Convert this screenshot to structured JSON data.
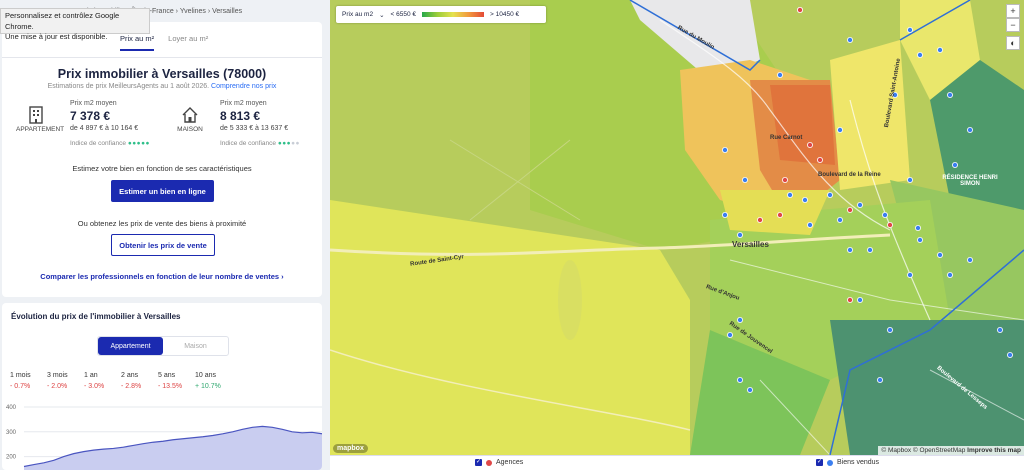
{
  "notification": {
    "line1": "Personnalisez et contrôlez Google Chrome.",
    "line2": "Une mise à jour est disponible."
  },
  "breadcrumb": "Prix immobilier › Île-de-France › Yvelines › Versailles",
  "tabs": [
    {
      "label": "Prix au m²",
      "active": true
    },
    {
      "label": "Loyer au m²",
      "active": false
    }
  ],
  "title": "Prix immobilier à Versailles (78000)",
  "subtitle": "Estimations de prix MeilleursAgents au 1 août 2026.",
  "subtitle_link": "Comprendre nos prix",
  "apartment": {
    "type_label": "APPARTEMENT",
    "label": "Prix m2 moyen",
    "price": "7 378 €",
    "range": "de 4 897 € à 10 164 €",
    "confidence_label": "Indice de confiance",
    "confidence_on": "●●●●●",
    "confidence_off": ""
  },
  "house": {
    "type_label": "MAISON",
    "label": "Prix m2 moyen",
    "price": "8 813 €",
    "range": "de 5 333 € à 13 637 €",
    "confidence_label": "Indice de confiance",
    "confidence_on": "●●●",
    "confidence_off": "●●"
  },
  "estimate_text": "Estimez votre bien en fonction de ses caractéristiques",
  "estimate_button": "Estimer un bien en ligne",
  "or_text": "Ou obtenez les prix de vente des biens à proximité",
  "sales_button": "Obtenir les prix de vente",
  "compare_link": "Comparer les professionnels en fonction de leur nombre de ventes ›",
  "evolution": {
    "title": "Évolution du prix de l'immobilier à Versailles",
    "segments": [
      {
        "label": "Appartement",
        "active": true
      },
      {
        "label": "Maison",
        "active": false
      }
    ],
    "periods": [
      {
        "label": "1 mois",
        "value": "- 0.7%"
      },
      {
        "label": "3 mois",
        "value": "- 2.0%"
      },
      {
        "label": "1 an",
        "value": "- 3.0%"
      },
      {
        "label": "2 ans",
        "value": "- 2.8%"
      },
      {
        "label": "5 ans",
        "value": "- 13.5%"
      },
      {
        "label": "10 ans",
        "value": "+ 10.7%"
      }
    ]
  },
  "chart_data": {
    "type": "area",
    "title": "",
    "xlabel": "",
    "ylabel": "",
    "ylim": [
      150,
      400
    ],
    "y_ticks": [
      400,
      300,
      200
    ],
    "values": [
      160,
      168,
      175,
      185,
      200,
      212,
      220,
      226,
      230,
      233,
      238,
      245,
      252,
      258,
      262,
      268,
      272,
      276,
      280,
      285,
      292,
      300,
      310,
      318,
      322,
      318,
      310,
      300,
      296,
      298,
      292
    ],
    "color": "#4a55c0",
    "fill": "#c9cdf0"
  },
  "map": {
    "legend_label": "Prix au m2",
    "legend_min": "< 6550 €",
    "legend_max": "> 10450 €",
    "places": [
      {
        "name": "Versailles"
      },
      {
        "name": "RÉSIDENCE HENRI SIMON"
      },
      {
        "name": "Route de Saint-Cyr"
      },
      {
        "name": "Rue Carnot"
      },
      {
        "name": "Boulevard de la Reine"
      },
      {
        "name": "Rue de Jouvencel"
      },
      {
        "name": "Rue du Moulin"
      },
      {
        "name": "Rue d'Anjou"
      },
      {
        "name": "Boulevard de Lesseps"
      },
      {
        "name": "Boulevard Saint-Antoine"
      }
    ],
    "attribution": "© Mapbox © OpenStreetMap",
    "improve": "Improve this map",
    "logo": "mapbox",
    "zoom_in": "+",
    "zoom_out": "−",
    "compass": "◐"
  },
  "footer": {
    "agencies": "Agences",
    "sold": "Biens vendus",
    "check": "✓"
  },
  "colors": {
    "brand": "#1b2ab0",
    "negative": "#d44",
    "positive": "#2fa86f",
    "agency_dot": "#e04848",
    "sold_dot": "#3b7ff0"
  }
}
